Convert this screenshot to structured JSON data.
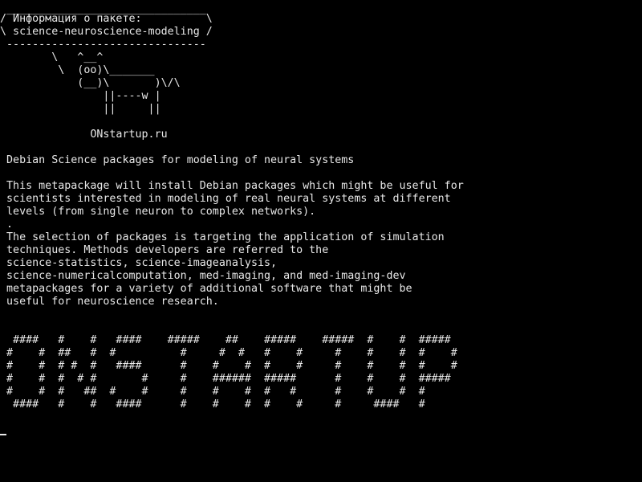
{
  "terminal": {
    "foreground": "#e8e8e8",
    "background": "#000000",
    "lines": [
      " _______________________________",
      "/ Информация о пакете:          \\",
      "\\ science-neuroscience-modeling /",
      " -------------------------------",
      "        \\   ^__^",
      "         \\  (oo)\\_______",
      "            (__)\\       )\\/\\",
      "                ||----w |",
      "                ||     ||",
      "",
      "              ONstartup.ru",
      "",
      " Debian Science packages for modeling of neural systems",
      "",
      " This metapackage will install Debian packages which might be useful for",
      " scientists interested in modeling of real neural systems at different",
      " levels (from single neuron to complex networks).",
      " .",
      " The selection of packages is targeting the application of simulation",
      " techniques. Methods developers are referred to the",
      " science-statistics, science-imageanalysis,",
      " science-numericalcomputation, med-imaging, and med-imaging-dev",
      " metapackages for a variety of additional software that might be",
      " useful for neuroscience research.",
      "",
      "",
      "  ####   #    #   ####    #####    ##    #####    #####  #    #  #####",
      " #    #  ##   #  #          #     #  #   #    #     #    #    #  #    #",
      " #    #  # #  #   ####      #    #    #  #    #     #    #    #  #    #",
      " #    #  #  # #       #     #    ######  #####      #    #    #  #####",
      " #    #  #   ##  #    #     #    #    #  #   #      #    #    #  #",
      "  ####   #    #   ####      #    #    #  #    #     #     ####   #"
    ]
  }
}
